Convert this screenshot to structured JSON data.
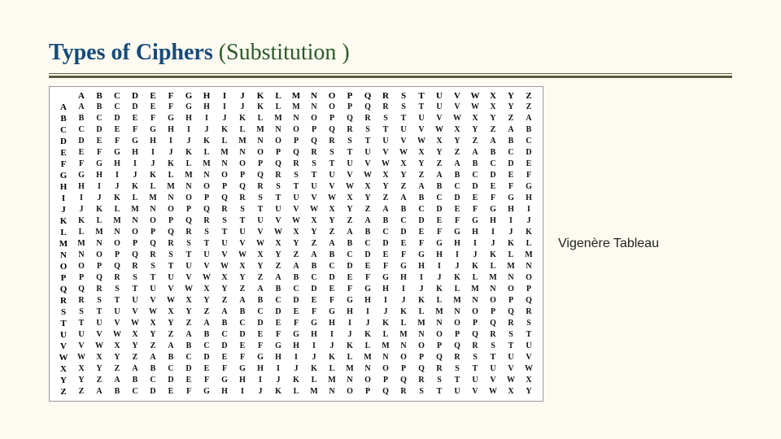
{
  "title": {
    "main": "Types of Ciphers ",
    "paren": "(Substitution )"
  },
  "caption": "Vigenère  Tableau",
  "chart_data": {
    "type": "table",
    "title": "Vigenère Tableau",
    "column_headers": [
      "A",
      "B",
      "C",
      "D",
      "E",
      "F",
      "G",
      "H",
      "I",
      "J",
      "K",
      "L",
      "M",
      "N",
      "O",
      "P",
      "Q",
      "R",
      "S",
      "T",
      "U",
      "V",
      "W",
      "X",
      "Y",
      "Z"
    ],
    "row_headers": [
      "A",
      "B",
      "C",
      "D",
      "E",
      "F",
      "G",
      "H",
      "I",
      "J",
      "K",
      "L",
      "M",
      "N",
      "O",
      "P",
      "Q",
      "R",
      "S",
      "T",
      "U",
      "V",
      "W",
      "X",
      "Y",
      "Z"
    ],
    "rows": [
      [
        "A",
        "B",
        "C",
        "D",
        "E",
        "F",
        "G",
        "H",
        "I",
        "J",
        "K",
        "L",
        "M",
        "N",
        "O",
        "P",
        "Q",
        "R",
        "S",
        "T",
        "U",
        "V",
        "W",
        "X",
        "Y",
        "Z"
      ],
      [
        "B",
        "C",
        "D",
        "E",
        "F",
        "G",
        "H",
        "I",
        "J",
        "K",
        "L",
        "M",
        "N",
        "O",
        "P",
        "Q",
        "R",
        "S",
        "T",
        "U",
        "V",
        "W",
        "X",
        "Y",
        "Z",
        "A"
      ],
      [
        "C",
        "D",
        "E",
        "F",
        "G",
        "H",
        "I",
        "J",
        "K",
        "L",
        "M",
        "N",
        "O",
        "P",
        "Q",
        "R",
        "S",
        "T",
        "U",
        "V",
        "W",
        "X",
        "Y",
        "Z",
        "A",
        "B"
      ],
      [
        "D",
        "E",
        "F",
        "G",
        "H",
        "I",
        "J",
        "K",
        "L",
        "M",
        "N",
        "O",
        "P",
        "Q",
        "R",
        "S",
        "T",
        "U",
        "V",
        "W",
        "X",
        "Y",
        "Z",
        "A",
        "B",
        "C"
      ],
      [
        "E",
        "F",
        "G",
        "H",
        "I",
        "J",
        "K",
        "L",
        "M",
        "N",
        "O",
        "P",
        "Q",
        "R",
        "S",
        "T",
        "U",
        "V",
        "W",
        "X",
        "Y",
        "Z",
        "A",
        "B",
        "C",
        "D"
      ],
      [
        "F",
        "G",
        "H",
        "I",
        "J",
        "K",
        "L",
        "M",
        "N",
        "O",
        "P",
        "Q",
        "R",
        "S",
        "T",
        "U",
        "V",
        "W",
        "X",
        "Y",
        "Z",
        "A",
        "B",
        "C",
        "D",
        "E"
      ],
      [
        "G",
        "H",
        "I",
        "J",
        "K",
        "L",
        "M",
        "N",
        "O",
        "P",
        "Q",
        "R",
        "S",
        "T",
        "U",
        "V",
        "W",
        "X",
        "Y",
        "Z",
        "A",
        "B",
        "C",
        "D",
        "E",
        "F"
      ],
      [
        "H",
        "I",
        "J",
        "K",
        "L",
        "M",
        "N",
        "O",
        "P",
        "Q",
        "R",
        "S",
        "T",
        "U",
        "V",
        "W",
        "X",
        "Y",
        "Z",
        "A",
        "B",
        "C",
        "D",
        "E",
        "F",
        "G"
      ],
      [
        "I",
        "J",
        "K",
        "L",
        "M",
        "N",
        "O",
        "P",
        "Q",
        "R",
        "S",
        "T",
        "U",
        "V",
        "W",
        "X",
        "Y",
        "Z",
        "A",
        "B",
        "C",
        "D",
        "E",
        "F",
        "G",
        "H"
      ],
      [
        "J",
        "K",
        "L",
        "M",
        "N",
        "O",
        "P",
        "Q",
        "R",
        "S",
        "T",
        "U",
        "V",
        "W",
        "X",
        "Y",
        "Z",
        "A",
        "B",
        "C",
        "D",
        "E",
        "F",
        "G",
        "H",
        "I"
      ],
      [
        "K",
        "L",
        "M",
        "N",
        "O",
        "P",
        "Q",
        "R",
        "S",
        "T",
        "U",
        "V",
        "W",
        "X",
        "Y",
        "Z",
        "A",
        "B",
        "C",
        "D",
        "E",
        "F",
        "G",
        "H",
        "I",
        "J"
      ],
      [
        "L",
        "M",
        "N",
        "O",
        "P",
        "Q",
        "R",
        "S",
        "T",
        "U",
        "V",
        "W",
        "X",
        "Y",
        "Z",
        "A",
        "B",
        "C",
        "D",
        "E",
        "F",
        "G",
        "H",
        "I",
        "J",
        "K"
      ],
      [
        "M",
        "N",
        "O",
        "P",
        "Q",
        "R",
        "S",
        "T",
        "U",
        "V",
        "W",
        "X",
        "Y",
        "Z",
        "A",
        "B",
        "C",
        "D",
        "E",
        "F",
        "G",
        "H",
        "I",
        "J",
        "K",
        "L"
      ],
      [
        "N",
        "O",
        "P",
        "Q",
        "R",
        "S",
        "T",
        "U",
        "V",
        "W",
        "X",
        "Y",
        "Z",
        "A",
        "B",
        "C",
        "D",
        "E",
        "F",
        "G",
        "H",
        "I",
        "J",
        "K",
        "L",
        "M"
      ],
      [
        "O",
        "P",
        "Q",
        "R",
        "S",
        "T",
        "U",
        "V",
        "W",
        "X",
        "Y",
        "Z",
        "A",
        "B",
        "C",
        "D",
        "E",
        "F",
        "G",
        "H",
        "I",
        "J",
        "K",
        "L",
        "M",
        "N"
      ],
      [
        "P",
        "Q",
        "R",
        "S",
        "T",
        "U",
        "V",
        "W",
        "X",
        "Y",
        "Z",
        "A",
        "B",
        "C",
        "D",
        "E",
        "F",
        "G",
        "H",
        "I",
        "J",
        "K",
        "L",
        "M",
        "N",
        "O"
      ],
      [
        "Q",
        "R",
        "S",
        "T",
        "U",
        "V",
        "W",
        "X",
        "Y",
        "Z",
        "A",
        "B",
        "C",
        "D",
        "E",
        "F",
        "G",
        "H",
        "I",
        "J",
        "K",
        "L",
        "M",
        "N",
        "O",
        "P"
      ],
      [
        "R",
        "S",
        "T",
        "U",
        "V",
        "W",
        "X",
        "Y",
        "Z",
        "A",
        "B",
        "C",
        "D",
        "E",
        "F",
        "G",
        "H",
        "I",
        "J",
        "K",
        "L",
        "M",
        "N",
        "O",
        "P",
        "Q"
      ],
      [
        "S",
        "T",
        "U",
        "V",
        "W",
        "X",
        "Y",
        "Z",
        "A",
        "B",
        "C",
        "D",
        "E",
        "F",
        "G",
        "H",
        "I",
        "J",
        "K",
        "L",
        "M",
        "N",
        "O",
        "P",
        "Q",
        "R"
      ],
      [
        "T",
        "U",
        "V",
        "W",
        "X",
        "Y",
        "Z",
        "A",
        "B",
        "C",
        "D",
        "E",
        "F",
        "G",
        "H",
        "I",
        "J",
        "K",
        "L",
        "M",
        "N",
        "O",
        "P",
        "Q",
        "R",
        "S"
      ],
      [
        "U",
        "V",
        "W",
        "X",
        "Y",
        "Z",
        "A",
        "B",
        "C",
        "D",
        "E",
        "F",
        "G",
        "H",
        "I",
        "J",
        "K",
        "L",
        "M",
        "N",
        "O",
        "P",
        "Q",
        "R",
        "S",
        "T"
      ],
      [
        "V",
        "W",
        "X",
        "Y",
        "Z",
        "A",
        "B",
        "C",
        "D",
        "E",
        "F",
        "G",
        "H",
        "I",
        "J",
        "K",
        "L",
        "M",
        "N",
        "O",
        "P",
        "Q",
        "R",
        "S",
        "T",
        "U"
      ],
      [
        "W",
        "X",
        "Y",
        "Z",
        "A",
        "B",
        "C",
        "D",
        "E",
        "F",
        "G",
        "H",
        "I",
        "J",
        "K",
        "L",
        "M",
        "N",
        "O",
        "P",
        "Q",
        "R",
        "S",
        "T",
        "U",
        "V"
      ],
      [
        "X",
        "Y",
        "Z",
        "A",
        "B",
        "C",
        "D",
        "E",
        "F",
        "G",
        "H",
        "I",
        "J",
        "K",
        "L",
        "M",
        "N",
        "O",
        "P",
        "Q",
        "R",
        "S",
        "T",
        "U",
        "V",
        "W"
      ],
      [
        "Y",
        "Z",
        "A",
        "B",
        "C",
        "D",
        "E",
        "F",
        "G",
        "H",
        "I",
        "J",
        "K",
        "L",
        "M",
        "N",
        "O",
        "P",
        "Q",
        "R",
        "S",
        "T",
        "U",
        "V",
        "W",
        "X"
      ],
      [
        "Z",
        "A",
        "B",
        "C",
        "D",
        "E",
        "F",
        "G",
        "H",
        "I",
        "J",
        "K",
        "L",
        "M",
        "N",
        "O",
        "P",
        "Q",
        "R",
        "S",
        "T",
        "U",
        "V",
        "W",
        "X",
        "Y"
      ]
    ]
  }
}
